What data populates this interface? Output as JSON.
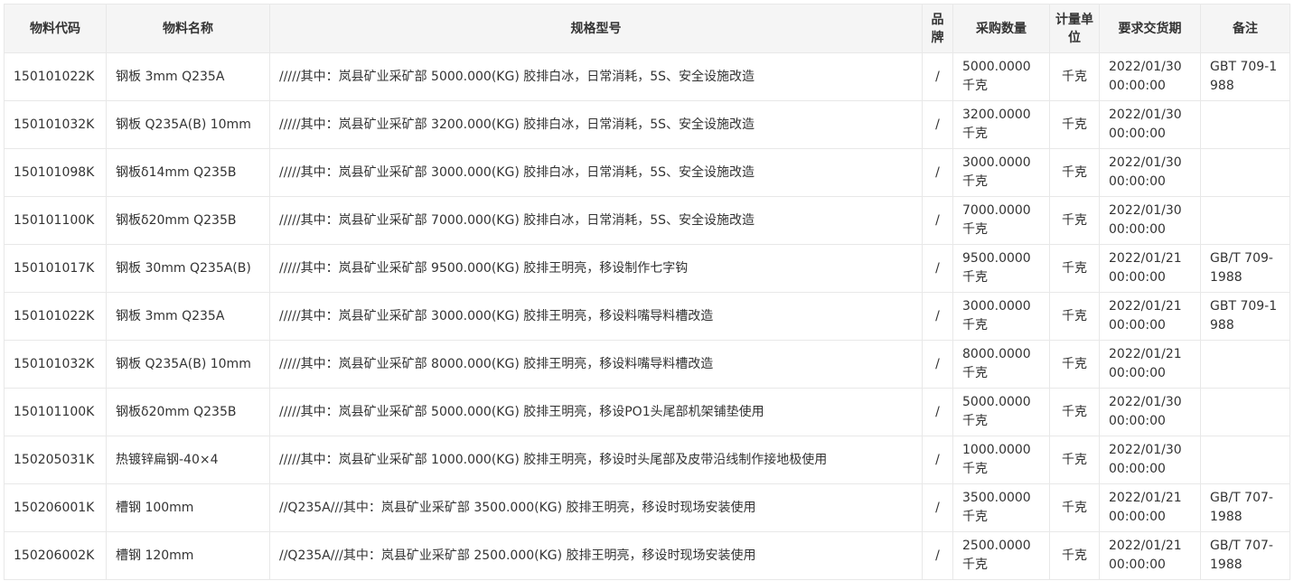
{
  "table": {
    "headers": [
      "物料代码",
      "物料名称",
      "规格型号",
      "品牌",
      "采购数量",
      "计量单位",
      "要求交货期",
      "备注"
    ],
    "rows": [
      {
        "code": "150101022K",
        "name": "钢板 3mm Q235A",
        "spec": "/////其中：岚县矿业采矿部 5000.000(KG) 胶排白冰，日常消耗，5S、安全设施改造",
        "brand": "/",
        "qty": "5000.0000 千克",
        "unit": "千克",
        "date": "2022/01/30 00:00:00",
        "remark": "GBT 709-1988"
      },
      {
        "code": "150101032K",
        "name": "钢板 Q235A(B) 10mm",
        "spec": "/////其中：岚县矿业采矿部 3200.000(KG) 胶排白冰，日常消耗，5S、安全设施改造",
        "brand": "/",
        "qty": "3200.0000 千克",
        "unit": "千克",
        "date": "2022/01/30 00:00:00",
        "remark": ""
      },
      {
        "code": "150101098K",
        "name": "钢板δ14mm Q235B",
        "spec": "/////其中：岚县矿业采矿部 3000.000(KG) 胶排白冰，日常消耗，5S、安全设施改造",
        "brand": "/",
        "qty": "3000.0000 千克",
        "unit": "千克",
        "date": "2022/01/30 00:00:00",
        "remark": ""
      },
      {
        "code": "150101100K",
        "name": "钢板δ20mm Q235B",
        "spec": "/////其中：岚县矿业采矿部 7000.000(KG) 胶排白冰，日常消耗，5S、安全设施改造",
        "brand": "/",
        "qty": "7000.0000 千克",
        "unit": "千克",
        "date": "2022/01/30 00:00:00",
        "remark": ""
      },
      {
        "code": "150101017K",
        "name": "钢板 30mm Q235A(B)",
        "spec": "/////其中：岚县矿业采矿部 9500.000(KG) 胶排王明亮，移设制作七字钩",
        "brand": "/",
        "qty": "9500.0000 千克",
        "unit": "千克",
        "date": "2022/01/21 00:00:00",
        "remark": "GB/T 709-1988"
      },
      {
        "code": "150101022K",
        "name": "钢板 3mm Q235A",
        "spec": "/////其中：岚县矿业采矿部 3000.000(KG) 胶排王明亮，移设料嘴导料槽改造",
        "brand": "/",
        "qty": "3000.0000 千克",
        "unit": "千克",
        "date": "2022/01/21 00:00:00",
        "remark": "GBT 709-1988"
      },
      {
        "code": "150101032K",
        "name": "钢板 Q235A(B) 10mm",
        "spec": "/////其中：岚县矿业采矿部 8000.000(KG) 胶排王明亮，移设料嘴导料槽改造",
        "brand": "/",
        "qty": "8000.0000 千克",
        "unit": "千克",
        "date": "2022/01/21 00:00:00",
        "remark": ""
      },
      {
        "code": "150101100K",
        "name": "钢板δ20mm Q235B",
        "spec": "/////其中：岚县矿业采矿部 5000.000(KG) 胶排王明亮，移设PO1头尾部机架铺垫使用",
        "brand": "/",
        "qty": "5000.0000 千克",
        "unit": "千克",
        "date": "2022/01/30 00:00:00",
        "remark": ""
      },
      {
        "code": "150205031K",
        "name": "热镀锌扁钢-40×4",
        "spec": "/////其中：岚县矿业采矿部 1000.000(KG) 胶排王明亮，移设时头尾部及皮带沿线制作接地极使用",
        "brand": "/",
        "qty": "1000.0000 千克",
        "unit": "千克",
        "date": "2022/01/30 00:00:00",
        "remark": ""
      },
      {
        "code": "150206001K",
        "name": "槽钢 100mm",
        "spec": "//Q235A///其中：岚县矿业采矿部 3500.000(KG) 胶排王明亮，移设时现场安装使用",
        "brand": "/",
        "qty": "3500.0000 千克",
        "unit": "千克",
        "date": "2022/01/21 00:00:00",
        "remark": "GB/T 707-1988"
      },
      {
        "code": "150206002K",
        "name": "槽钢 120mm",
        "spec": "//Q235A///其中：岚县矿业采矿部 2500.000(KG) 胶排王明亮，移设时现场安装使用",
        "brand": "/",
        "qty": "2500.0000 千克",
        "unit": "千克",
        "date": "2022/01/21 00:00:00",
        "remark": "GB/T 707-1988"
      }
    ]
  },
  "colors": {
    "header_bg": "#f5f5f5",
    "border": "#e8e8e8",
    "text": "#333333"
  }
}
